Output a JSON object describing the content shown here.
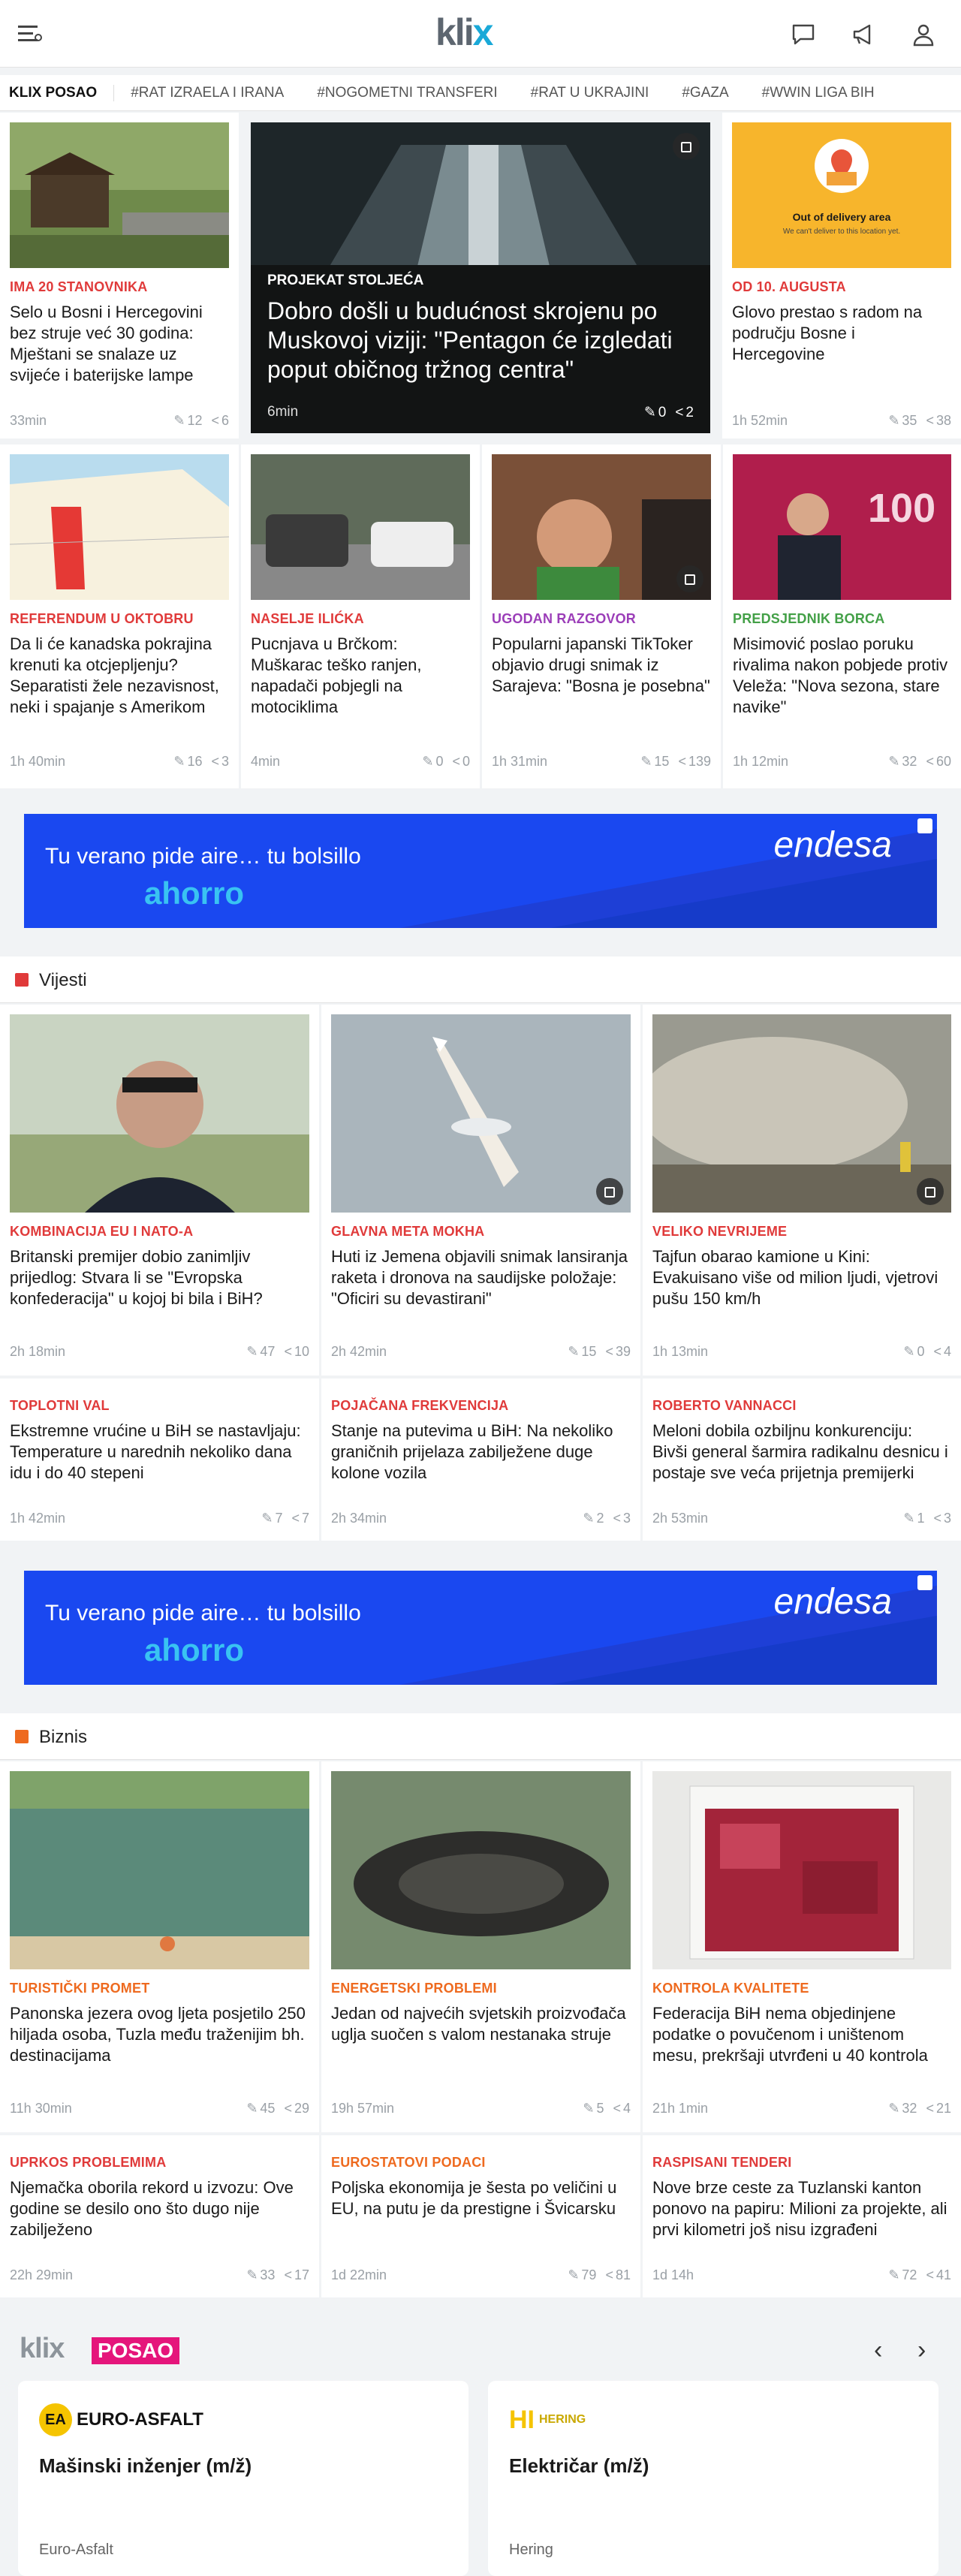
{
  "header": {
    "logo": "klix",
    "hamburger_icon": "menu-icon",
    "comments_icon": "chat-icon",
    "megaphone_icon": "megaphone-icon",
    "user_icon": "user-icon"
  },
  "tags": [
    "KLIX POSAO",
    "#RAT IZRAELA I IRANA",
    "#NOGOMETNI TRANSFERI",
    "#RAT U UKRAJINI",
    "#GAZA",
    "#WWIN LIGA BIH"
  ],
  "top": {
    "c1": {
      "cat": "IMA 20 STANOVNIKA",
      "title": "Selo u Bosni i Hercegovini bez struje već 30 godina: Mještani se snalaze uz svijeće i baterijske lampe",
      "time": "33min",
      "comments": "12",
      "shares": "6"
    },
    "feature": {
      "cat": "PROJEKAT STOLJEĆA",
      "title": "Dobro došli u budućnost skrojenu po Muskovoj viziji: \"Pentagon će izgledati poput običnog tržnog centra\"",
      "time": "6min",
      "comments": "0",
      "shares": "2"
    },
    "c3": {
      "cat": "OD 10. AUGUSTA",
      "title": "Glovo prestao s radom na području Bosne i Hercegovine",
      "time": "1h 52min",
      "comments": "35",
      "shares": "38",
      "img_title": "Out of delivery area",
      "img_sub": "We can't deliver to this location yet."
    },
    "r1": {
      "cat": "REFERENDUM U OKTOBRU",
      "title": "Da li će kanadska pokrajina krenuti ka otcjepljenju? Separatisti žele nezavisnost, neki i spajanje s Amerikom",
      "time": "1h 40min",
      "comments": "16",
      "shares": "3"
    },
    "r2": {
      "cat": "NASELJE ILIĆKA",
      "title": "Pucnjava u Brčkom: Muškarac teško ranjen, napadači pobjegli na motociklima",
      "time": "4min",
      "comments": "0",
      "shares": "0"
    },
    "r3": {
      "cat": "UGODAN RAZGOVOR",
      "title": "Popularni japanski TikToker objavio drugi snimak iz Sarajeva: \"Bosna je posebna\"",
      "time": "1h 31min",
      "comments": "15",
      "shares": "139"
    },
    "r4": {
      "cat": "PREDSJEDNIK BORCA",
      "title": "Misimović poslao poruku rivalima nakon pobjede protiv Veleža: \"Nova sezona, stare navike\"",
      "time": "1h 12min",
      "comments": "32",
      "shares": "60"
    }
  },
  "ad": {
    "line1": "Tu verano pide aire… tu bolsillo",
    "line2": "ahorro",
    "brand": "endesa"
  },
  "vijesti": {
    "label": "Vijesti",
    "v1": {
      "cat": "KOMBINACIJA EU I NATO-A",
      "title": "Britanski premijer dobio zanimljiv prijedlog: Stvara li se \"Evropska konfederacija\" u kojoj bi bila i BiH?",
      "time": "2h 18min",
      "comments": "47",
      "shares": "10"
    },
    "v2": {
      "cat": "GLAVNA META MOKHA",
      "title": "Huti iz Jemena objavili snimak lansiranja raketa i dronova na saudijske položaje: \"Oficiri su devastirani\"",
      "time": "2h 42min",
      "comments": "15",
      "shares": "39"
    },
    "v3": {
      "cat": "VELIKO NEVRIJEME",
      "title": "Tajfun obarao kamione u Kini: Evakuisano više od milion ljudi, vjetrovi pušu 150 km/h",
      "time": "1h 13min",
      "comments": "0",
      "shares": "4"
    },
    "v4": {
      "cat": "TOPLOTNI VAL",
      "title": "Ekstremne vrućine u BiH se nastavljaju: Temperature u narednih nekoliko dana idu i do 40 stepeni",
      "time": "1h 42min",
      "comments": "7",
      "shares": "7"
    },
    "v5": {
      "cat": "POJAČANA FREKVENCIJA",
      "title": "Stanje na putevima u BiH: Na nekoliko graničnih prijelaza zabilježene duge kolone vozila",
      "time": "2h 34min",
      "comments": "2",
      "shares": "3"
    },
    "v6": {
      "cat": "ROBERTO VANNACCI",
      "title": "Meloni dobila ozbiljnu konkurenciju: Bivši general šarmira radikalnu desnicu i postaje sve veća prijetnja premijerki",
      "time": "2h 53min",
      "comments": "1",
      "shares": "3"
    }
  },
  "biznis": {
    "label": "Biznis",
    "b1": {
      "cat": "TURISTIČKI PROMET",
      "title": "Panonska jezera ovog ljeta posjetilo 250 hiljada osoba, Tuzla među traženijim bh. destinacijama",
      "time": "11h 30min",
      "comments": "45",
      "shares": "29"
    },
    "b2": {
      "cat": "ENERGETSKI PROBLEMI",
      "title": "Jedan od najvećih svjetskih proizvođača uglja suočen s valom nestanaka struje",
      "time": "19h 57min",
      "comments": "5",
      "shares": "4"
    },
    "b3": {
      "cat": "KONTROLA KVALITETE",
      "title": "Federacija BiH nema objedinjene podatke o povučenom i uništenom mesu, prekršaji utvrđeni u 40 kontrola",
      "time": "21h 1min",
      "comments": "32",
      "shares": "21"
    },
    "b4": {
      "cat": "UPRKOS PROBLEMIMA",
      "title": "Njemačka oborila rekord u izvozu: Ove godine se desilo ono što dugo nije zabilježeno",
      "time": "22h 29min",
      "comments": "33",
      "shares": "17"
    },
    "b5": {
      "cat": "EUROSTATOVI PODACI",
      "title": "Poljska ekonomija je šesta po veličini u EU, na putu je da prestigne i Švicarsku",
      "time": "1d 22min",
      "comments": "79",
      "shares": "81"
    },
    "b6": {
      "cat": "RASPISANI TENDERI",
      "title": "Nove brze ceste za Tuzlanski kanton ponovo na papiru: Milioni za projekte, ali prvi kilometri još nisu izgrađeni",
      "time": "1d 14h",
      "comments": "72",
      "shares": "41"
    }
  },
  "posao": {
    "logo": "klix",
    "badge": "POSAO",
    "jobs": [
      {
        "logo": "EURO-ASFALT",
        "logo_mark": "EA",
        "title": "Mašinski inženjer (m/ž)",
        "company": "Euro-Asfalt"
      },
      {
        "logo": "HERING",
        "logo_mark": "HI",
        "title": "Električar (m/ž)",
        "company": "Hering"
      }
    ]
  },
  "colors": {
    "accent": "#1aa9d8",
    "red": "#e03a3a",
    "purple": "#9b3db8",
    "green": "#43a047",
    "orange": "#ee6a1f",
    "ad_bg": "#1a48f0",
    "posao_pink": "#e5157b"
  }
}
